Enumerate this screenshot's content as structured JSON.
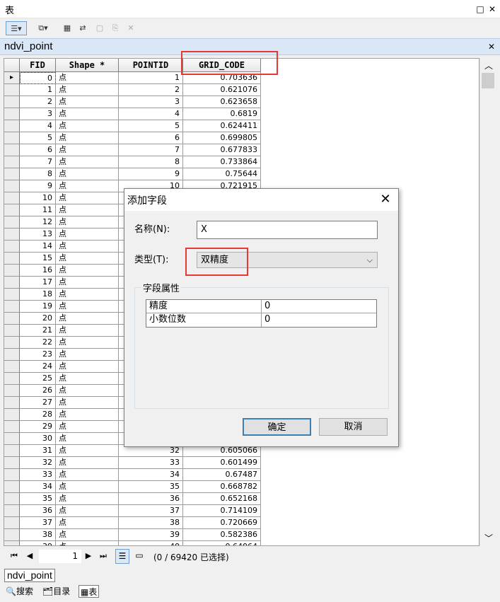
{
  "window": {
    "title": "表"
  },
  "table": {
    "name": "ndvi_point",
    "columns": [
      "FID",
      "Shape *",
      "POINTID",
      "GRID_CODE"
    ],
    "rows": [
      [
        "0",
        "点",
        "1",
        "0.703636"
      ],
      [
        "1",
        "点",
        "2",
        "0.621076"
      ],
      [
        "2",
        "点",
        "3",
        "0.623658"
      ],
      [
        "3",
        "点",
        "4",
        "0.6819"
      ],
      [
        "4",
        "点",
        "5",
        "0.624411"
      ],
      [
        "5",
        "点",
        "6",
        "0.699805"
      ],
      [
        "6",
        "点",
        "7",
        "0.677833"
      ],
      [
        "7",
        "点",
        "8",
        "0.733864"
      ],
      [
        "8",
        "点",
        "9",
        "0.75644"
      ],
      [
        "9",
        "点",
        "10",
        "0.721915"
      ],
      [
        "10",
        "点",
        "",
        ""
      ],
      [
        "11",
        "点",
        "",
        ""
      ],
      [
        "12",
        "点",
        "",
        ""
      ],
      [
        "13",
        "点",
        "",
        ""
      ],
      [
        "14",
        "点",
        "",
        ""
      ],
      [
        "15",
        "点",
        "",
        ""
      ],
      [
        "16",
        "点",
        "",
        ""
      ],
      [
        "17",
        "点",
        "",
        ""
      ],
      [
        "18",
        "点",
        "",
        ""
      ],
      [
        "19",
        "点",
        "",
        ""
      ],
      [
        "20",
        "点",
        "",
        ""
      ],
      [
        "21",
        "点",
        "",
        ""
      ],
      [
        "22",
        "点",
        "",
        ""
      ],
      [
        "23",
        "点",
        "",
        ""
      ],
      [
        "24",
        "点",
        "",
        ""
      ],
      [
        "25",
        "点",
        "",
        ""
      ],
      [
        "26",
        "点",
        "",
        ""
      ],
      [
        "27",
        "点",
        "",
        ""
      ],
      [
        "28",
        "点",
        "",
        ""
      ],
      [
        "29",
        "点",
        "",
        ""
      ],
      [
        "30",
        "点",
        "",
        ""
      ],
      [
        "31",
        "点",
        "32",
        "0.605066"
      ],
      [
        "32",
        "点",
        "33",
        "0.601499"
      ],
      [
        "33",
        "点",
        "34",
        "0.67487"
      ],
      [
        "34",
        "点",
        "35",
        "0.668782"
      ],
      [
        "35",
        "点",
        "36",
        "0.652168"
      ],
      [
        "36",
        "点",
        "37",
        "0.714109"
      ],
      [
        "37",
        "点",
        "38",
        "0.720669"
      ],
      [
        "38",
        "点",
        "39",
        "0.582386"
      ],
      [
        "39",
        "点",
        "40",
        "0.64064"
      ]
    ]
  },
  "nav": {
    "record": "1",
    "status": "(0 / 69420 已选择)"
  },
  "bottom": {
    "active_table": "ndvi_point",
    "tabs": [
      "搜索",
      "目录",
      "表"
    ]
  },
  "dialog": {
    "title": "添加字段",
    "name_label": "名称(N):",
    "name_value": "X",
    "type_label": "类型(T):",
    "type_value": "双精度",
    "group_title": "字段属性",
    "props": [
      {
        "key": "精度",
        "value": "0"
      },
      {
        "key": "小数位数",
        "value": "0"
      }
    ],
    "ok": "确定",
    "cancel": "取消"
  },
  "colors": {
    "highlight": "#e53935",
    "tab_bg": "#d9e7f7",
    "focus_border": "#3c7fb1"
  }
}
